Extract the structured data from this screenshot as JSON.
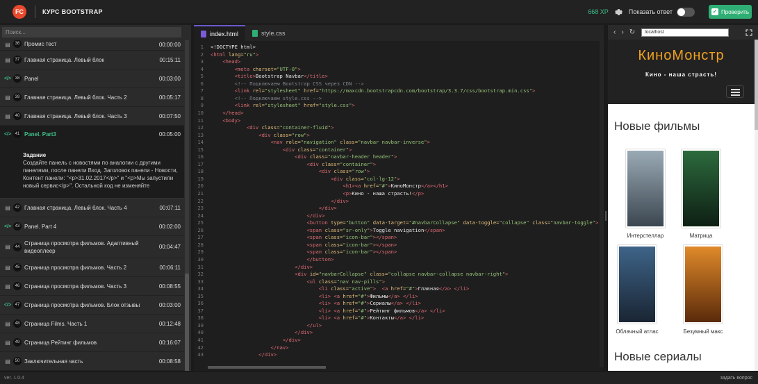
{
  "header": {
    "logo_text": "FC",
    "course_title": "КУРС BOOTSTRAP",
    "xp": "668 XP",
    "show_answer_label": "Показать ответ",
    "check_label": "Проверить"
  },
  "sidebar": {
    "search_placeholder": "Поиск...",
    "lessons": [
      {
        "num": "36",
        "type": "video",
        "title": "Промис тест",
        "time": "00:00:00",
        "cut": true
      },
      {
        "num": "37",
        "type": "video",
        "title": "Главная страница. Левый блок",
        "time": "00:15:11"
      },
      {
        "num": "38",
        "type": "code",
        "title": "Panel",
        "time": "00:03:00"
      },
      {
        "num": "39",
        "type": "video",
        "title": "Главная страница. Левый блок. Часть 2",
        "time": "00:05:17"
      },
      {
        "num": "40",
        "type": "video",
        "title": "Главная страница. Левый блок. Часть 3",
        "time": "00:07:50"
      },
      {
        "num": "41",
        "type": "code",
        "title": "Panel. Part3",
        "time": "00:05:00",
        "active": true
      },
      {
        "num": "42",
        "type": "video",
        "title": "Главная страница. Левый блок. Часть 4",
        "time": "00:07:11"
      },
      {
        "num": "43",
        "type": "code",
        "title": "Panel. Part 4",
        "time": "00:02:00"
      },
      {
        "num": "44",
        "type": "video",
        "title": "Страница просмотра фильмов. Адаптивный видеоплеер",
        "time": "00:04:47",
        "tall": true
      },
      {
        "num": "45",
        "type": "video",
        "title": "Страница просмотра фильмов. Часть 2",
        "time": "00:06:11"
      },
      {
        "num": "46",
        "type": "video",
        "title": "Страница просмотра фильмов. Часть 3",
        "time": "00:08:55"
      },
      {
        "num": "47",
        "type": "code",
        "title": "Страница просмотра фильмов. Блок отзывы",
        "time": "00:03:00"
      },
      {
        "num": "48",
        "type": "video",
        "title": "Страница Films. Часть 1",
        "time": "00:12:48"
      },
      {
        "num": "49",
        "type": "video",
        "title": "Страница Рейтинг фильмов",
        "time": "00:16:07"
      },
      {
        "num": "50",
        "type": "video",
        "title": "Заключительная часть",
        "time": "00:08:58"
      }
    ],
    "task": {
      "heading": "Задание",
      "text": "Создайте панель с новостями по аналогии с другими панелями, после панели Вход. Заголовок панели - Новости, Контент панели: \"<p>31.02.2017</p>\" и \"<p>Мы запустили новый сервис</p>\". Остальной код не изменяйте"
    }
  },
  "editor": {
    "tabs": [
      {
        "label": "index.html",
        "active": true
      },
      {
        "label": "style.css",
        "active": false
      }
    ],
    "code": [
      [
        [
          "w",
          "<!DOCTYPE html>"
        ]
      ],
      [
        [
          "t",
          "<html "
        ],
        [
          "a",
          "lang="
        ],
        [
          "s",
          "\"ru\""
        ],
        [
          "t",
          ">"
        ]
      ],
      [
        [
          "w",
          "    "
        ],
        [
          "t",
          "<head>"
        ]
      ],
      [
        [
          "w",
          "        "
        ],
        [
          "t",
          "<meta "
        ],
        [
          "a",
          "charset="
        ],
        [
          "s",
          "\"UTF-8\""
        ],
        [
          "t",
          ">"
        ]
      ],
      [
        [
          "w",
          "        "
        ],
        [
          "t",
          "<title>"
        ],
        [
          "w",
          "Bootstrap Navbar"
        ],
        [
          "t",
          "</title>"
        ]
      ],
      [
        [
          "w",
          "        "
        ],
        [
          "c",
          "<!-- Подключаем Bootstrap CSS через CDN -->"
        ]
      ],
      [
        [
          "w",
          "        "
        ],
        [
          "t",
          "<link "
        ],
        [
          "a",
          "rel="
        ],
        [
          "s",
          "\"stylesheet\""
        ],
        [
          "a",
          " href="
        ],
        [
          "s",
          "\"https://maxcdn.bootstrapcdn.com/bootstrap/3.3.7/css/bootstrap.min.css\""
        ],
        [
          "t",
          ">"
        ]
      ],
      [
        [
          "w",
          "        "
        ],
        [
          "c",
          "<!-- Подключаем style.css -->"
        ]
      ],
      [
        [
          "w",
          "        "
        ],
        [
          "t",
          "<link "
        ],
        [
          "a",
          "rel="
        ],
        [
          "s",
          "\"stylesheet\""
        ],
        [
          "a",
          " href="
        ],
        [
          "s",
          "\"style.css\""
        ],
        [
          "t",
          ">"
        ]
      ],
      [
        [
          "w",
          "    "
        ],
        [
          "t",
          "</head>"
        ]
      ],
      [
        [
          "w",
          "    "
        ],
        [
          "t",
          "<body>"
        ]
      ],
      [
        [
          "w",
          "            "
        ],
        [
          "t",
          "<div "
        ],
        [
          "a",
          "class="
        ],
        [
          "s",
          "\"container-fluid\""
        ],
        [
          "t",
          ">"
        ]
      ],
      [
        [
          "w",
          "                "
        ],
        [
          "t",
          "<div "
        ],
        [
          "a",
          "class="
        ],
        [
          "s",
          "\"row\""
        ],
        [
          "t",
          ">"
        ]
      ],
      [
        [
          "w",
          "                    "
        ],
        [
          "t",
          "<nav "
        ],
        [
          "a",
          "role="
        ],
        [
          "s",
          "\"navigation\""
        ],
        [
          "a",
          " class="
        ],
        [
          "s",
          "\"navbar navbar-inverse\""
        ],
        [
          "t",
          ">"
        ]
      ],
      [
        [
          "w",
          "                        "
        ],
        [
          "t",
          "<div "
        ],
        [
          "a",
          "class="
        ],
        [
          "s",
          "\"container\""
        ],
        [
          "t",
          ">"
        ]
      ],
      [
        [
          "w",
          "                            "
        ],
        [
          "t",
          "<div "
        ],
        [
          "a",
          "class="
        ],
        [
          "s",
          "\"navbar-header header\""
        ],
        [
          "t",
          ">"
        ]
      ],
      [
        [
          "w",
          "                                "
        ],
        [
          "t",
          "<div "
        ],
        [
          "a",
          "class="
        ],
        [
          "s",
          "\"container\""
        ],
        [
          "t",
          ">"
        ]
      ],
      [
        [
          "w",
          "                                    "
        ],
        [
          "t",
          "<div "
        ],
        [
          "a",
          "class="
        ],
        [
          "s",
          "\"row\""
        ],
        [
          "t",
          ">"
        ]
      ],
      [
        [
          "w",
          "                                        "
        ],
        [
          "t",
          "<div "
        ],
        [
          "a",
          "class="
        ],
        [
          "s",
          "\"col-lg-12\""
        ],
        [
          "t",
          ">"
        ]
      ],
      [
        [
          "w",
          "                                            "
        ],
        [
          "t",
          "<h1><a "
        ],
        [
          "a",
          "href="
        ],
        [
          "s",
          "\"#\""
        ],
        [
          "t",
          ">"
        ],
        [
          "w",
          "КиноМонстр"
        ],
        [
          "t",
          "</a></h1>"
        ]
      ],
      [
        [
          "w",
          "                                            "
        ],
        [
          "t",
          "<p>"
        ],
        [
          "w",
          "Кино - наша страсть!"
        ],
        [
          "t",
          "</p>"
        ]
      ],
      [
        [
          "w",
          "                                        "
        ],
        [
          "t",
          "</div>"
        ]
      ],
      [
        [
          "w",
          "                                    "
        ],
        [
          "t",
          "</div>"
        ]
      ],
      [
        [
          "w",
          "                                "
        ],
        [
          "t",
          "</div>"
        ]
      ],
      [
        [
          "w",
          "                                "
        ],
        [
          "t",
          "<button "
        ],
        [
          "a",
          "type="
        ],
        [
          "s",
          "\"button\""
        ],
        [
          "a",
          " data-target="
        ],
        [
          "s",
          "\"#navbarCollapse\""
        ],
        [
          "a",
          " data-toggle="
        ],
        [
          "s",
          "\"collapse\""
        ],
        [
          "a",
          " class="
        ],
        [
          "s",
          "\"navbar-toggle\""
        ],
        [
          "t",
          ">"
        ]
      ],
      [
        [
          "w",
          "                                "
        ],
        [
          "t",
          "<span "
        ],
        [
          "a",
          "class="
        ],
        [
          "s",
          "\"sr-only\""
        ],
        [
          "t",
          ">"
        ],
        [
          "w",
          "Toggle navigation"
        ],
        [
          "t",
          "</span>"
        ]
      ],
      [
        [
          "w",
          "                                "
        ],
        [
          "t",
          "<span "
        ],
        [
          "a",
          "class="
        ],
        [
          "s",
          "\"icon-bar\""
        ],
        [
          "t",
          "></span>"
        ]
      ],
      [
        [
          "w",
          "                                "
        ],
        [
          "t",
          "<span "
        ],
        [
          "a",
          "class="
        ],
        [
          "s",
          "\"icon-bar\""
        ],
        [
          "t",
          "></span>"
        ]
      ],
      [
        [
          "w",
          "                                "
        ],
        [
          "t",
          "<span "
        ],
        [
          "a",
          "class="
        ],
        [
          "s",
          "\"icon-bar\""
        ],
        [
          "t",
          "></span>"
        ]
      ],
      [
        [
          "w",
          "                                "
        ],
        [
          "t",
          "</button>"
        ]
      ],
      [
        [
          "w",
          "                            "
        ],
        [
          "t",
          "</div>"
        ]
      ],
      [
        [
          "w",
          "                            "
        ],
        [
          "t",
          "<div "
        ],
        [
          "a",
          "id="
        ],
        [
          "s",
          "\"navbarCollapse\""
        ],
        [
          "a",
          " class="
        ],
        [
          "s",
          "\"collapse navbar-collapse navbar-right\""
        ],
        [
          "t",
          ">"
        ]
      ],
      [
        [
          "w",
          "                                "
        ],
        [
          "t",
          "<ul "
        ],
        [
          "a",
          "class="
        ],
        [
          "s",
          "\"nav nav-pills\""
        ],
        [
          "t",
          ">"
        ]
      ],
      [
        [
          "w",
          "                                    "
        ],
        [
          "t",
          "<li "
        ],
        [
          "a",
          "class="
        ],
        [
          "s",
          "\"active\""
        ],
        [
          "t",
          ">  <a "
        ],
        [
          "a",
          "href="
        ],
        [
          "s",
          "\"#\""
        ],
        [
          "t",
          ">"
        ],
        [
          "w",
          "Главная"
        ],
        [
          "t",
          "</a> </li>"
        ]
      ],
      [
        [
          "w",
          "                                    "
        ],
        [
          "t",
          "<li> <a "
        ],
        [
          "a",
          "href="
        ],
        [
          "s",
          "\"#\""
        ],
        [
          "t",
          ">"
        ],
        [
          "w",
          "Фильмы"
        ],
        [
          "t",
          "</a> </li>"
        ]
      ],
      [
        [
          "w",
          "                                    "
        ],
        [
          "t",
          "<li> <a "
        ],
        [
          "a",
          "href="
        ],
        [
          "s",
          "\"#\""
        ],
        [
          "t",
          ">"
        ],
        [
          "w",
          "Сериалы"
        ],
        [
          "t",
          "</a> </li>"
        ]
      ],
      [
        [
          "w",
          "                                    "
        ],
        [
          "t",
          "<li> <a "
        ],
        [
          "a",
          "href="
        ],
        [
          "s",
          "\"#\""
        ],
        [
          "t",
          ">"
        ],
        [
          "w",
          "Рейтинг фильмов"
        ],
        [
          "t",
          "</a> </li>"
        ]
      ],
      [
        [
          "w",
          "                                    "
        ],
        [
          "t",
          "<li> <a "
        ],
        [
          "a",
          "href="
        ],
        [
          "s",
          "\"#\""
        ],
        [
          "t",
          ">"
        ],
        [
          "w",
          "Контакты"
        ],
        [
          "t",
          "</a> </li>"
        ]
      ],
      [
        [
          "w",
          "                                "
        ],
        [
          "t",
          "</ul>"
        ]
      ],
      [
        [
          "w",
          "                            "
        ],
        [
          "t",
          "</div>"
        ]
      ],
      [
        [
          "w",
          "                        "
        ],
        [
          "t",
          "</div>"
        ]
      ],
      [
        [
          "w",
          "                    "
        ],
        [
          "t",
          "</nav>"
        ]
      ],
      [
        [
          "w",
          "                "
        ],
        [
          "t",
          "</div>"
        ]
      ]
    ]
  },
  "preview": {
    "url": "localhost",
    "brand": "КиноМонстр",
    "slogan": "Кино - наша страсть!",
    "films_heading": "Новые фильмы",
    "series_heading": "Новые сериалы",
    "films": [
      {
        "name": "Интерстеллар",
        "poster_color": "#6e7f8c"
      },
      {
        "name": "Матрица",
        "poster_color": "#1f4a2e"
      },
      {
        "name": "Облачный атлас",
        "poster_color": "#2f4a66"
      },
      {
        "name": "Безумный макс",
        "poster_color": "#c8701e"
      }
    ]
  },
  "footer": {
    "version": "ver. 1.0.4",
    "ask": "задать вопрос"
  }
}
